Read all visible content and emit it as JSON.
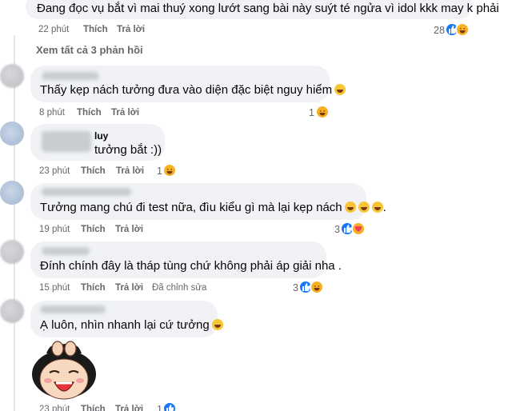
{
  "top_comment": {
    "text": "Đang đọc vụ bắt vì mai thuý xong lướt sang bài này suýt té ngửa vì idol kkk may k phải",
    "time": "22 phút",
    "like": "Thích",
    "reply": "Trả lời",
    "reactions": "28"
  },
  "view_replies": "Xem tất cả 3 phản hồi",
  "replies": [
    {
      "text": "Thấy kẹp nách tưởng đưa vào diện đặc biệt nguy hiểm",
      "time": "8 phút",
      "like": "Thích",
      "reply": "Trả lời",
      "reactions": "1"
    },
    {
      "name_partial": "luy",
      "text": "tưởng bắt :))",
      "time": "23 phút",
      "like": "Thích",
      "reply": "Trả lời",
      "reactions": "1"
    },
    {
      "text": "Tưởng mang chú đi test nữa, đìu kiểu gì mà lại kẹp nách",
      "text_tail": ".",
      "time": "19 phút",
      "like": "Thích",
      "reply": "Trả lời",
      "reactions": "3"
    },
    {
      "text": "Đính chính đây là tháp tùng chứ không phải áp giải nha .",
      "time": "15 phút",
      "like": "Thích",
      "reply": "Trả lời",
      "edited": "Đã chỉnh sửa",
      "reactions": "3"
    },
    {
      "text": "Ạ luôn, nhìn nhanh lại cứ tưởng",
      "time": "23 phút",
      "like": "Thích",
      "reply": "Trả lời",
      "reactions": "1"
    }
  ],
  "icons": {
    "like": "like-reaction-icon",
    "haha": "haha-reaction-icon",
    "love": "love-reaction-icon",
    "sticker": "laughing-cartoon-sticker"
  },
  "colors": {
    "bubble": "#f0f2f5",
    "meta": "#65676b",
    "like_blue": "#1877f2",
    "haha_yellow": "#f7b125"
  }
}
